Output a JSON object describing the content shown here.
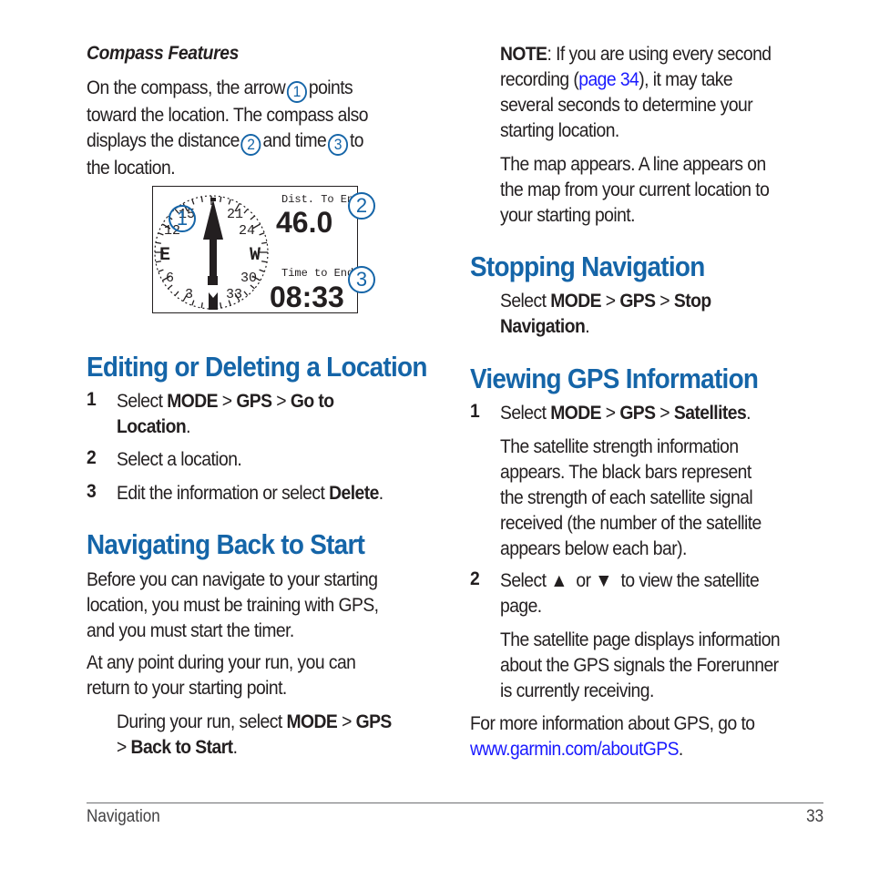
{
  "left": {
    "compass_features": {
      "heading": "Compass Features",
      "para_parts": [
        "On the compass, the arrow",
        "points",
        "toward the location. The compass also",
        "displays the distance",
        "and time",
        "to",
        "the location."
      ],
      "callouts": [
        "1",
        "2",
        "3"
      ]
    },
    "figure": {
      "dist_label": "Dist. To End",
      "dist_value": "46.0",
      "time_label": "Time to End",
      "time_value": "08:33",
      "compass_labels": [
        "21",
        "24",
        "W",
        "30",
        "33",
        "3",
        "6",
        "E",
        "12",
        "15"
      ],
      "callouts": [
        "1",
        "2",
        "3"
      ]
    },
    "editing": {
      "heading": "Editing or Deleting a Location",
      "steps": [
        {
          "num": "1",
          "parts": [
            "Select ",
            "MODE",
            " > ",
            "GPS",
            " > ",
            "Go to",
            "Location",
            "."
          ]
        },
        {
          "num": "2",
          "text": "Select a location."
        },
        {
          "num": "3",
          "parts": [
            "Edit the information or select ",
            "Delete",
            "."
          ]
        }
      ]
    },
    "back_to_start": {
      "heading": "Navigating Back to Start",
      "para1": [
        "Before you can navigate to your starting",
        "location, you must be training with GPS,",
        "and you must start the timer."
      ],
      "para2": [
        "At any point during your run, you can",
        "return to your starting point."
      ],
      "instruction": [
        "During your run, select ",
        "MODE",
        " > ",
        "GPS",
        "> ",
        "Back to Start",
        "."
      ]
    }
  },
  "right": {
    "note": {
      "label": "NOTE",
      "line1": ": If you are using every second",
      "line2_pre": "recording (",
      "link": "page 34",
      "line2_post": "), it may take",
      "line3": "several seconds to determine your",
      "line4": "starting location."
    },
    "map_para": [
      "The map appears. A line appears on",
      "the map from your current location to",
      "your starting point."
    ],
    "stopping": {
      "heading": "Stopping Navigation",
      "parts": [
        "Select ",
        "MODE",
        " > ",
        "GPS",
        " > ",
        "Stop",
        "Navigation",
        "."
      ]
    },
    "viewing": {
      "heading": "Viewing GPS Information",
      "step1": {
        "num": "1",
        "parts": [
          "Select ",
          "MODE",
          " > ",
          "GPS",
          " > ",
          "Satellites",
          "."
        ]
      },
      "step1_para": [
        "The satellite strength information",
        "appears. The black bars represent",
        "the strength of each satellite signal",
        "received (the number of the satellite",
        "appears below each bar)."
      ],
      "step2": {
        "num": "2",
        "pre": "Select ",
        "up": "▲",
        "mid": "  or ",
        "down": "▼",
        "post": "  to view the satellite",
        "line2": "page."
      },
      "step2_para": [
        "The satellite page displays information",
        "about the GPS signals the Forerunner",
        "is currently receiving."
      ],
      "more": "For more information about GPS, go to",
      "url": "www.garmin.com/aboutGPS",
      "url_post": "."
    }
  },
  "footer": {
    "section": "Navigation",
    "page": "33"
  },
  "colors": {
    "heading": "#1565a8",
    "link": "#1a1aff",
    "text": "#231f20"
  }
}
